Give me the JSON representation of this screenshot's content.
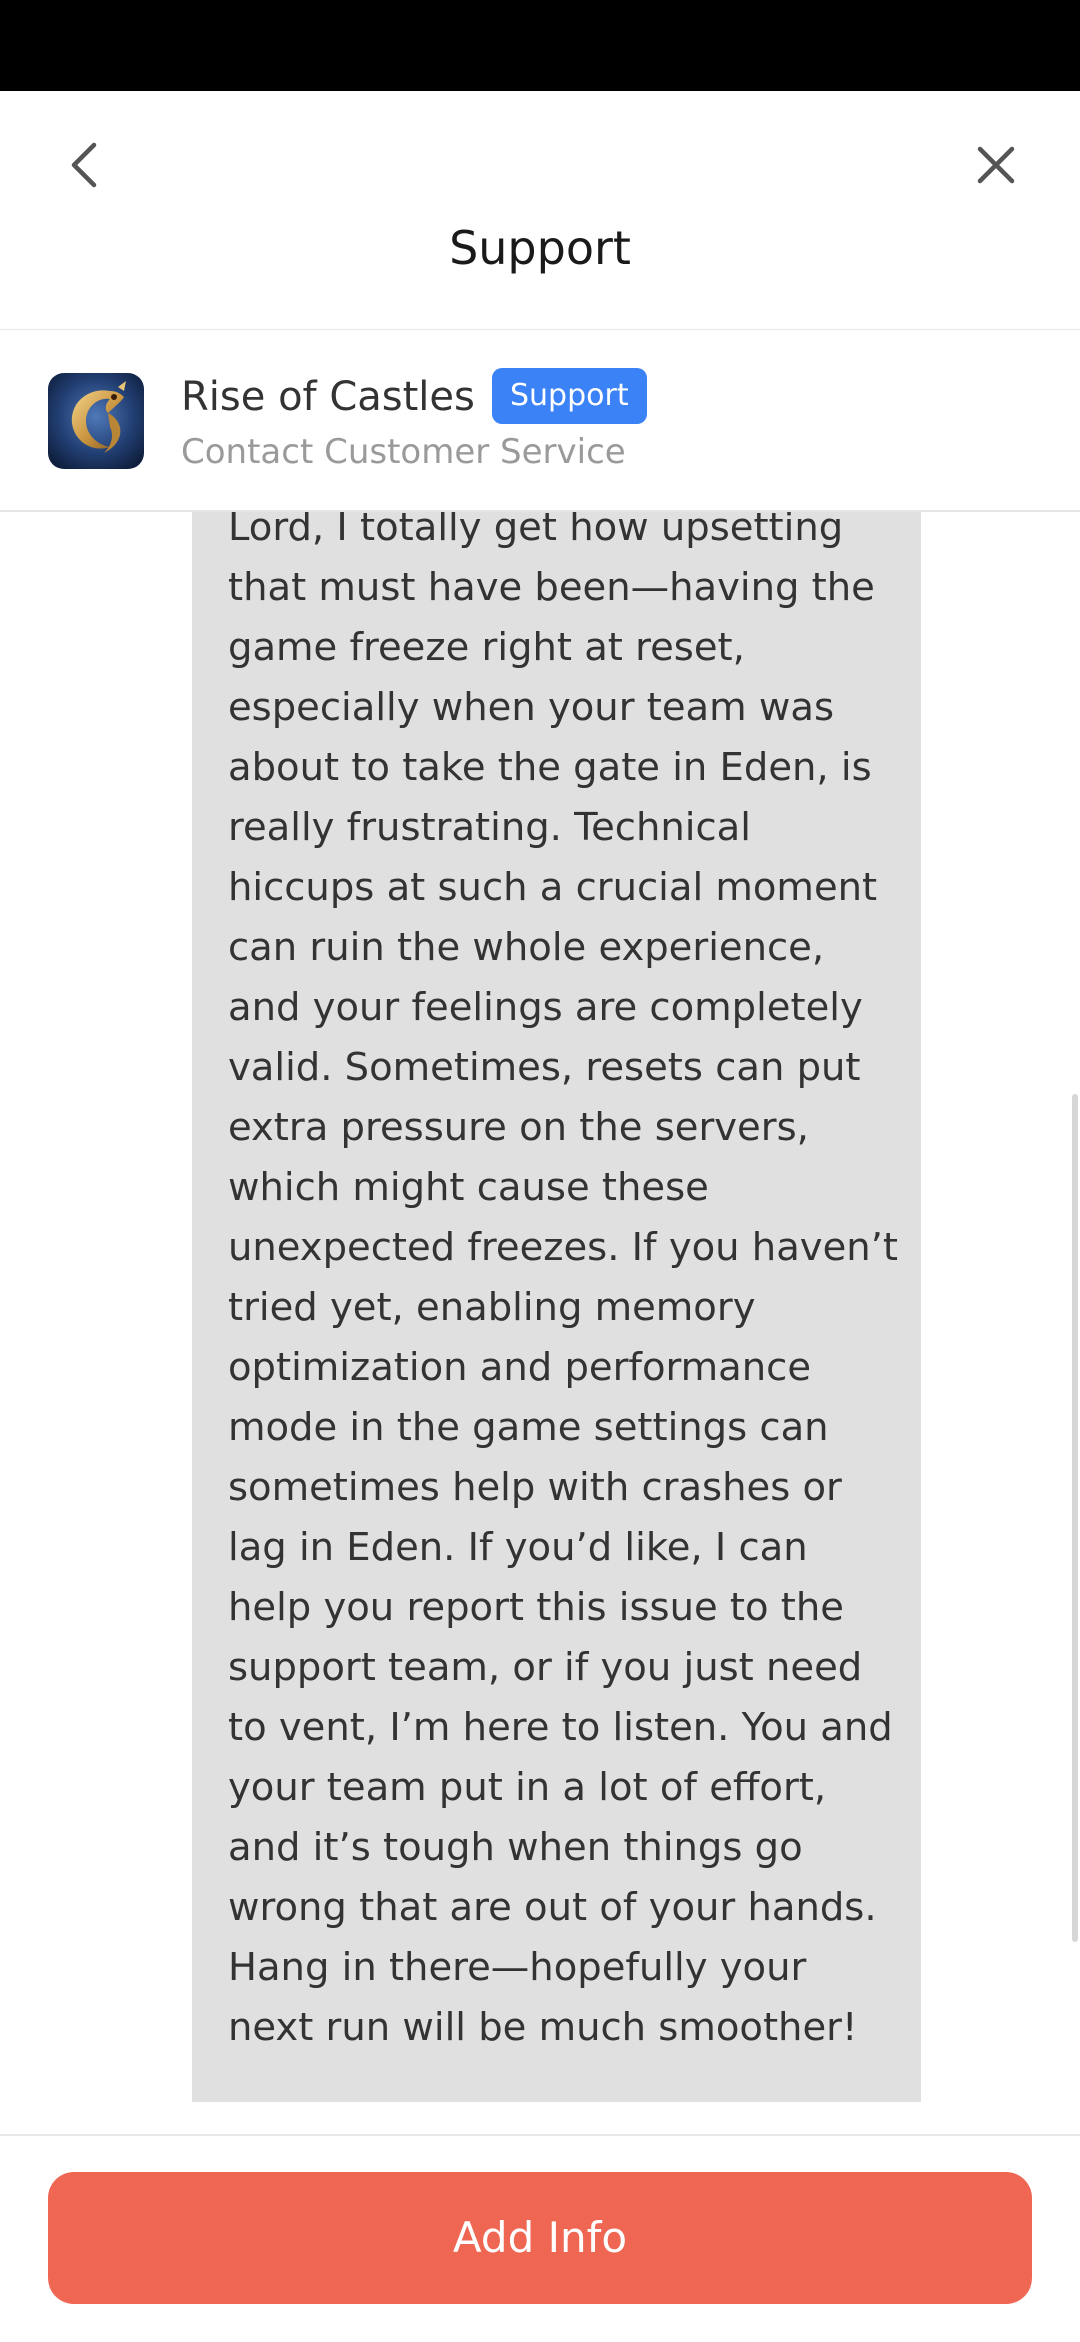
{
  "nav": {
    "title": "Support",
    "back_icon": "chevron-left-icon",
    "close_icon": "close-icon"
  },
  "app": {
    "name": "Rise of Castles",
    "badge": "Support",
    "subtitle": "Contact Customer Service",
    "icon": "game-dragon-icon",
    "badge_color": "#3b82f6"
  },
  "message": {
    "text": "Lord, I totally get how upsetting that must have been—having the game freeze right at reset, especially when your team was about to take the gate in Eden, is really frustrating. Technical hiccups at such a crucial moment can ruin the whole experience, and your feelings are completely valid. Sometimes, resets can put extra pressure on the servers, which might cause these unexpected freezes. If you haven’t tried yet, enabling memory optimization and performance mode in the game settings can sometimes help with crashes or lag in Eden. If you’d like, I can help you report this issue to the support team, or if you just need to vent, I’m here to listen. You and your team put in a lot of effort, and it’s tough when things go wrong that are out of your hands. Hang in there—hopefully your next run will be much smoother!",
    "bubble_color": "#e0e0e0"
  },
  "footer": {
    "add_info_label": "Add Info",
    "button_color": "#ef6653"
  }
}
